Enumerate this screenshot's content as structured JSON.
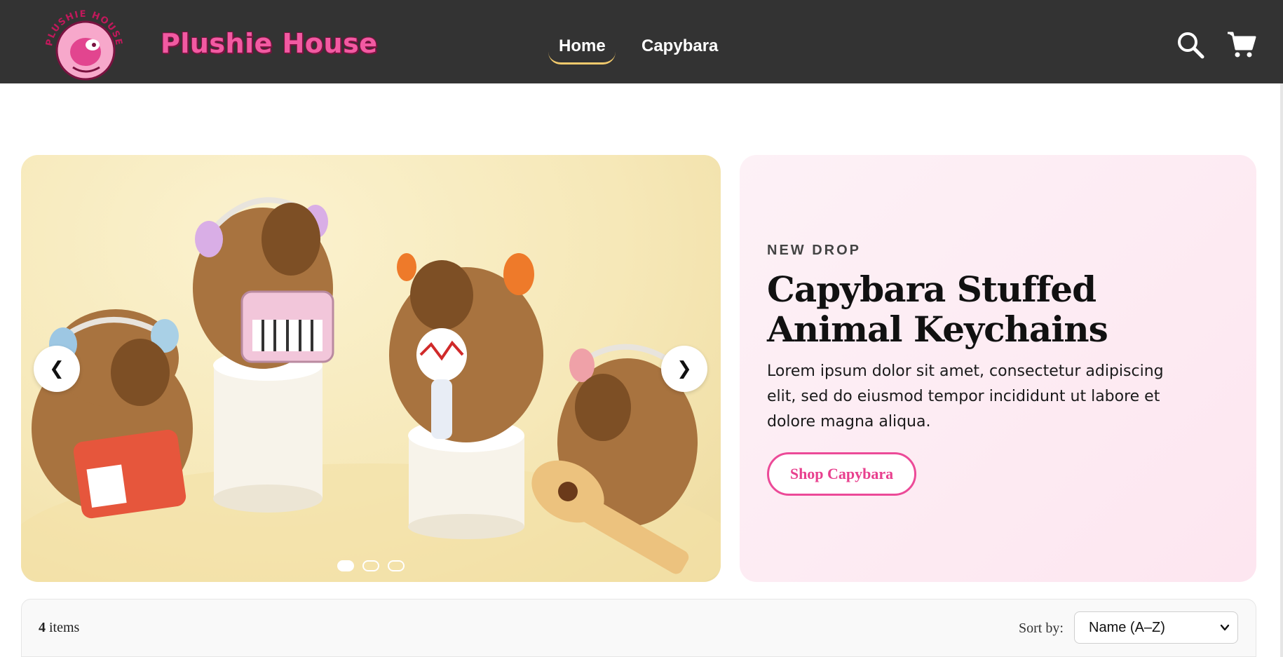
{
  "header": {
    "logo_text": "PLUSHIE HOUSE",
    "brand": "Plushie House",
    "nav": [
      {
        "label": "Home",
        "active": true
      },
      {
        "label": "Capybara",
        "active": false
      }
    ],
    "icons": [
      "search-icon",
      "cart-icon"
    ]
  },
  "slider": {
    "prev_label": "❮",
    "next_label": "❯",
    "slide_count": 3,
    "active_slide": 1
  },
  "promo": {
    "eyebrow": "NEW DROP",
    "title": "Capybara Stuffed Animal Keychains",
    "body": "Lorem ipsum dolor sit amet, consectetur adipiscing elit, sed do eiusmod tempor incididunt ut labore et dolore magna aliqua.",
    "cta": "Shop Capybara"
  },
  "toolbar": {
    "count": "4",
    "count_suffix": " items",
    "sort_label": "Sort by:",
    "sort_value": "Name (A–Z)"
  },
  "colors": {
    "header_bg": "#333333",
    "brand_pink": "#f25aa2",
    "nav_underline": "#f1c96c",
    "promo_bg": "#fde9f2",
    "cta_border": "#ec4a98"
  }
}
